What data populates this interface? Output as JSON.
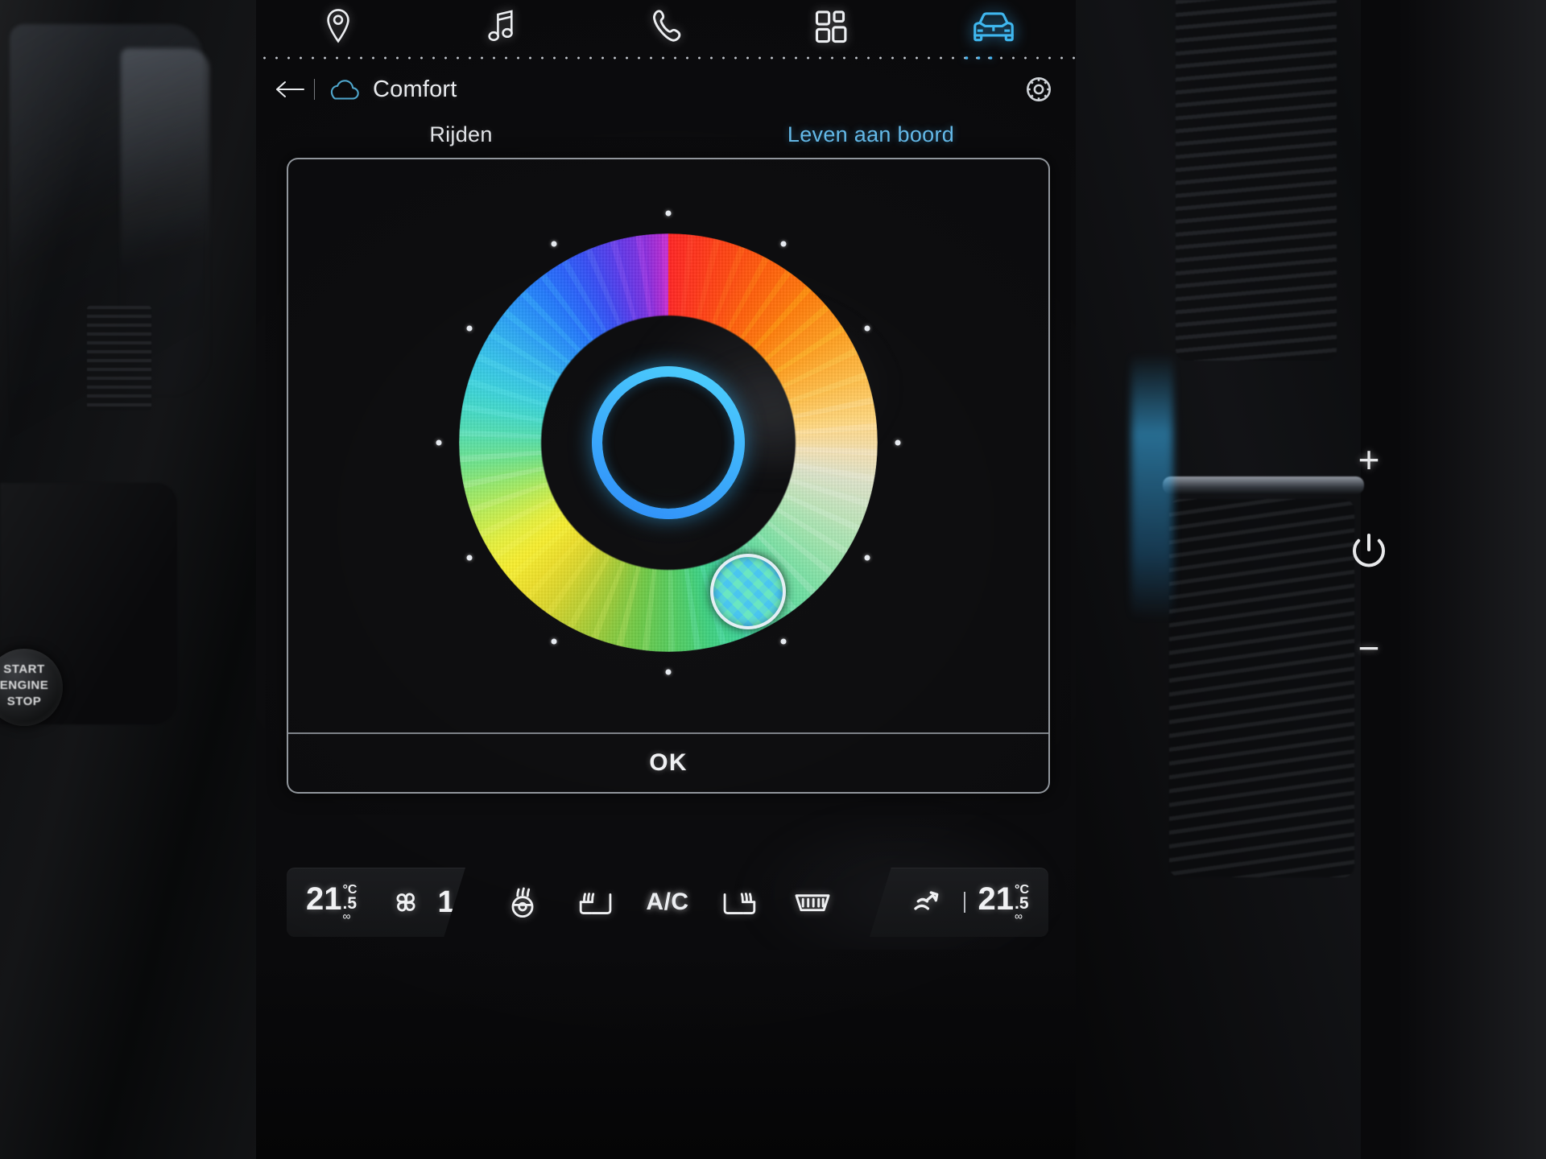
{
  "topnav": {
    "items": [
      {
        "name": "navigation",
        "icon": "map-pin-icon",
        "active": false
      },
      {
        "name": "media",
        "icon": "music-note-icon",
        "active": false
      },
      {
        "name": "phone",
        "icon": "phone-icon",
        "active": false
      },
      {
        "name": "apps",
        "icon": "grid-apps-icon",
        "active": false
      },
      {
        "name": "vehicle",
        "icon": "car-icon",
        "active": true
      }
    ],
    "active_index": 4,
    "active_color": "#3fb7ef"
  },
  "header": {
    "back_label": "←",
    "icon": "cloud-icon",
    "title": "Comfort",
    "settings_icon": "gear-icon"
  },
  "tabs": [
    {
      "label": "Rijden",
      "active": false
    },
    {
      "label": "Leven aan boord",
      "active": true
    }
  ],
  "dialog": {
    "ok_label": "OK",
    "color_picker": {
      "type": "hue-wheel",
      "selected_hue_deg": 186,
      "selected_color": "#4fd6d8",
      "preview_ring_color": "#38b6f2",
      "handle_angle_deg": 62,
      "tick_count": 12
    }
  },
  "climate": {
    "left": {
      "temperature": "21",
      "temperature_decimal": ".5",
      "unit": "°C",
      "sync_icon": "link-icon",
      "separator": "|",
      "fan_icon": "fan-icon",
      "fan_level": "1"
    },
    "center_controls": [
      {
        "name": "heated-steering-wheel",
        "icon": "steering-wheel-heat-icon"
      },
      {
        "name": "heated-seat-left",
        "icon": "seat-heat-icon"
      },
      {
        "name": "air-conditioning",
        "icon": "text",
        "label": "A/C"
      },
      {
        "name": "heated-seat-right",
        "icon": "seat-heat-icon"
      },
      {
        "name": "rear-defrost",
        "icon": "rear-defrost-icon"
      }
    ],
    "right": {
      "airflow_icon": "airflow-direction-icon",
      "separator": "|",
      "temperature": "21",
      "temperature_decimal": ".5",
      "unit": "°C",
      "sync_icon": "link-icon"
    }
  },
  "hardware": {
    "volume_up": "+",
    "power": "power-icon",
    "volume_down": "−",
    "start_engine_label": "START ENGINE STOP"
  }
}
